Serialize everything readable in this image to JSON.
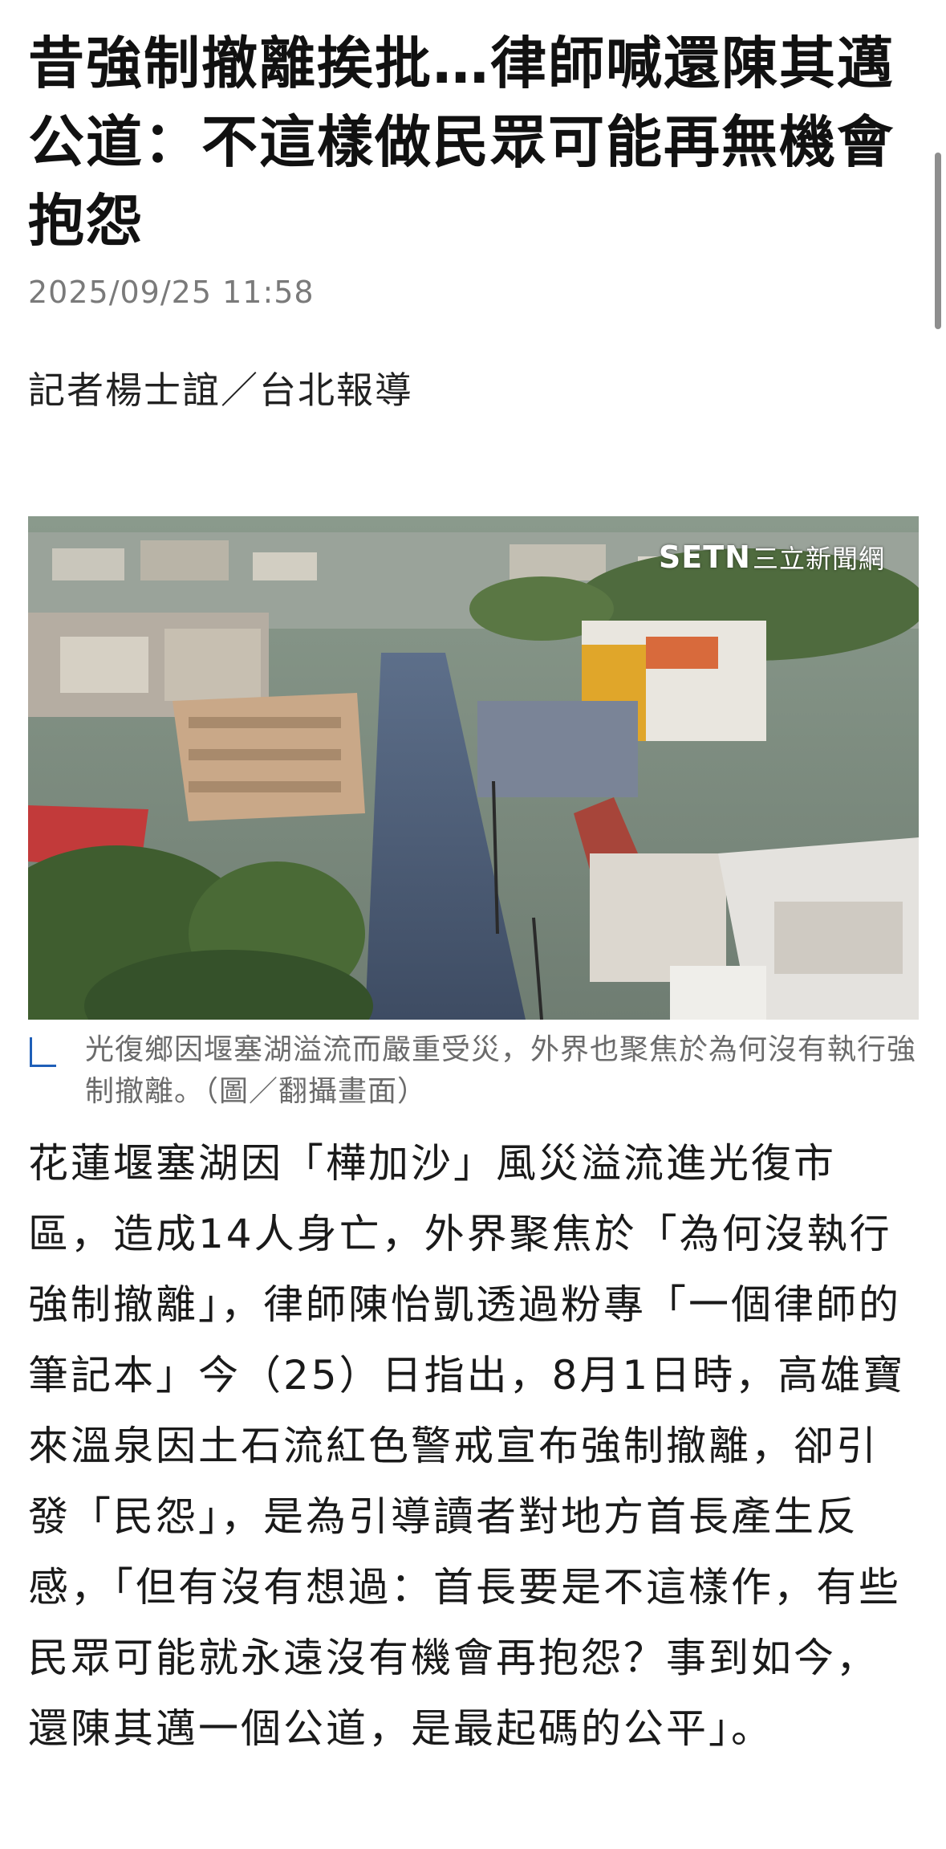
{
  "article": {
    "headline": "昔強制撤離挨批…律師喊還陳其邁公道：不這樣做民眾可能再無機會抱怨",
    "timestamp": "2025/09/25 11:58",
    "byline": "記者楊士誼／台北報導",
    "photo": {
      "watermark_brand": "SETN",
      "watermark_name": "三立新聞網",
      "caption": "光復鄉因堰塞湖溢流而嚴重受災，外界也聚焦於為何沒有執行強制撤離。（圖／翻攝畫面）"
    },
    "body": "花蓮堰塞湖因「樺加沙」風災溢流進光復市區，造成14人身亡，外界聚焦於「為何沒執行強制撤離」，律師陳怡凱透過粉專「一個律師的筆記本」今（25）日指出，8月1日時，高雄寶來溫泉因土石流紅色警戒宣布強制撤離，卻引發「民怨」，是為引導讀者對地方首長產生反感，「但有沒有想過：首長要是不這樣作，有些民眾可能就永遠沒有機會再抱怨？事到如今，還陳其邁一個公道，是最起碼的公平」。"
  },
  "colors": {
    "caption_accent": "#1f5fb8",
    "timestamp": "#7a7a7a",
    "caption_text": "#6b6b6b"
  }
}
